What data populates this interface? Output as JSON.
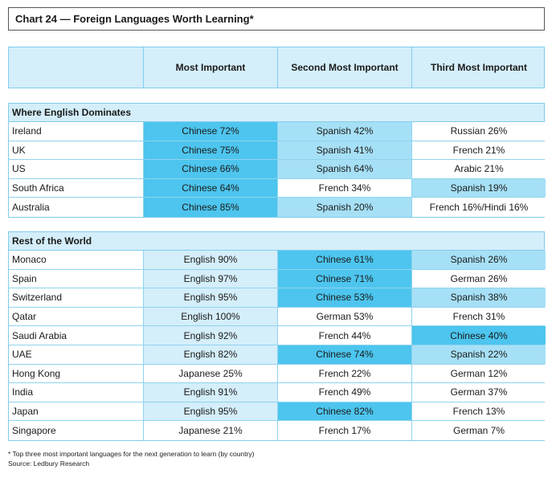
{
  "title": "Chart 24 — Foreign Languages Worth Learning*",
  "colors": {
    "strong": "#4dc5ee",
    "medium": "#a6e0f6",
    "light": "#d4eefa",
    "none": "#ffffff",
    "border": "#7fcdee"
  },
  "chart_data": {
    "type": "table",
    "columns": [
      "",
      "Most Important",
      "Second Most Important",
      "Third Most Important"
    ],
    "sections": [
      {
        "name": "Where English Dominates",
        "rows": [
          {
            "country": "Ireland",
            "cells": [
              {
                "text": "Chinese 72%",
                "shade": "strong"
              },
              {
                "text": "Spanish 42%",
                "shade": "medium"
              },
              {
                "text": "Russian 26%",
                "shade": "none"
              }
            ]
          },
          {
            "country": "UK",
            "cells": [
              {
                "text": "Chinese 75%",
                "shade": "strong"
              },
              {
                "text": "Spanish 41%",
                "shade": "medium"
              },
              {
                "text": "French 21%",
                "shade": "none"
              }
            ]
          },
          {
            "country": "US",
            "cells": [
              {
                "text": "Chinese 66%",
                "shade": "strong"
              },
              {
                "text": "Spanish 64%",
                "shade": "medium"
              },
              {
                "text": "Arabic 21%",
                "shade": "none"
              }
            ]
          },
          {
            "country": "South Africa",
            "cells": [
              {
                "text": "Chinese 64%",
                "shade": "strong"
              },
              {
                "text": "French 34%",
                "shade": "none"
              },
              {
                "text": "Spanish 19%",
                "shade": "medium"
              }
            ]
          },
          {
            "country": "Australia",
            "cells": [
              {
                "text": "Chinese 85%",
                "shade": "strong"
              },
              {
                "text": "Spanish 20%",
                "shade": "medium"
              },
              {
                "text": "French 16%/Hindi 16%",
                "shade": "none"
              }
            ]
          }
        ]
      },
      {
        "name": "Rest of the World",
        "rows": [
          {
            "country": "Monaco",
            "cells": [
              {
                "text": "English 90%",
                "shade": "light"
              },
              {
                "text": "Chinese 61%",
                "shade": "strong"
              },
              {
                "text": "Spanish 26%",
                "shade": "medium"
              }
            ]
          },
          {
            "country": "Spain",
            "cells": [
              {
                "text": "English 97%",
                "shade": "light"
              },
              {
                "text": "Chinese 71%",
                "shade": "strong"
              },
              {
                "text": "German 26%",
                "shade": "none"
              }
            ]
          },
          {
            "country": "Switzerland",
            "cells": [
              {
                "text": "English 95%",
                "shade": "light"
              },
              {
                "text": "Chinese 53%",
                "shade": "strong"
              },
              {
                "text": "Spanish 38%",
                "shade": "medium"
              }
            ]
          },
          {
            "country": "Qatar",
            "cells": [
              {
                "text": "English 100%",
                "shade": "light"
              },
              {
                "text": "German 53%",
                "shade": "none"
              },
              {
                "text": "French 31%",
                "shade": "none"
              }
            ]
          },
          {
            "country": "Saudi Arabia",
            "cells": [
              {
                "text": "English 92%",
                "shade": "light"
              },
              {
                "text": "French 44%",
                "shade": "none"
              },
              {
                "text": "Chinese 40%",
                "shade": "strong"
              }
            ]
          },
          {
            "country": "UAE",
            "cells": [
              {
                "text": "English 82%",
                "shade": "light"
              },
              {
                "text": "Chinese 74%",
                "shade": "strong"
              },
              {
                "text": "Spanish 22%",
                "shade": "medium"
              }
            ]
          },
          {
            "country": "Hong Kong",
            "cells": [
              {
                "text": "Japanese 25%",
                "shade": "none"
              },
              {
                "text": "French 22%",
                "shade": "none"
              },
              {
                "text": "German 12%",
                "shade": "none"
              }
            ]
          },
          {
            "country": "India",
            "cells": [
              {
                "text": "English 91%",
                "shade": "light"
              },
              {
                "text": "French 49%",
                "shade": "none"
              },
              {
                "text": "German 37%",
                "shade": "none"
              }
            ]
          },
          {
            "country": "Japan",
            "cells": [
              {
                "text": "English 95%",
                "shade": "light"
              },
              {
                "text": "Chinese 82%",
                "shade": "strong"
              },
              {
                "text": "French 13%",
                "shade": "none"
              }
            ]
          },
          {
            "country": "Singapore",
            "cells": [
              {
                "text": "Japanese 21%",
                "shade": "none"
              },
              {
                "text": "French 17%",
                "shade": "none"
              },
              {
                "text": "German 7%",
                "shade": "none"
              }
            ]
          }
        ]
      }
    ]
  },
  "footnote": "* Top three most important languages for the next generation to learn (by country)",
  "source": "Source: Ledbury Research"
}
